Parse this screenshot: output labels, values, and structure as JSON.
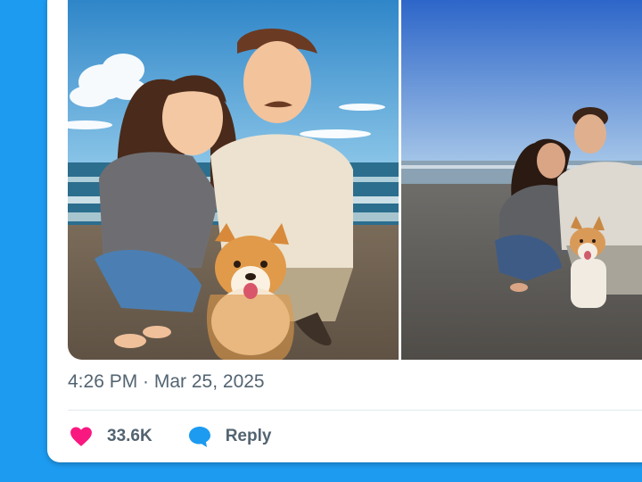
{
  "tweet": {
    "timestamp": "4:26 PM · Mar 25, 2025",
    "likes_count": "33.6K",
    "reply_label": "Reply"
  },
  "media": {
    "images": [
      {
        "name": "anime-style-illustration"
      },
      {
        "name": "beach-photo"
      }
    ]
  },
  "icons": {
    "like": "heart-icon",
    "reply": "speech-bubble-icon"
  },
  "colors": {
    "background": "#1d9bf0",
    "like_accent": "#f91880",
    "reply_accent": "#1d9bf0",
    "muted_text": "#536471"
  }
}
